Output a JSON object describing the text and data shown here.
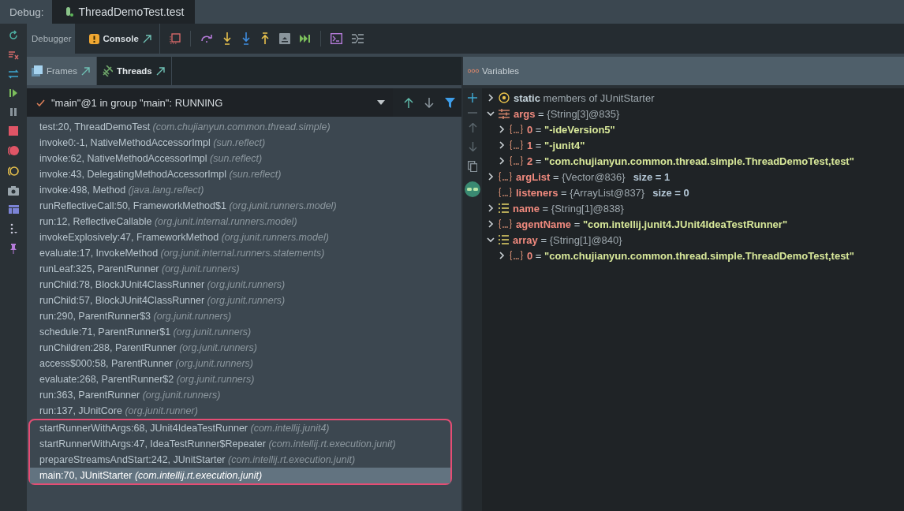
{
  "debug_bar": {
    "label": "Debug:",
    "tab": {
      "title": "ThreadDemoTest.test",
      "selected": true
    }
  },
  "tool_tabs": [
    {
      "label": "Debugger",
      "selected": true,
      "kind": "plain"
    },
    {
      "label": "Console",
      "selected": false,
      "kind": "warning"
    }
  ],
  "frame_tabs": [
    {
      "label": "Frames",
      "selected": true,
      "kind": "frames"
    },
    {
      "label": "Threads",
      "selected": false,
      "kind": "threads"
    }
  ],
  "thread_selector": {
    "value": "\"main\"@1 in group \"main\": RUNNING"
  },
  "frames": [
    {
      "location": "test:20, ThreadDemoTest",
      "package": "(com.chujianyun.common.thread.simple)",
      "selected": false,
      "marked": false
    },
    {
      "location": "invoke0:-1, NativeMethodAccessorImpl",
      "package": "(sun.reflect)",
      "selected": false,
      "marked": false
    },
    {
      "location": "invoke:62, NativeMethodAccessorImpl",
      "package": "(sun.reflect)",
      "selected": false,
      "marked": false
    },
    {
      "location": "invoke:43, DelegatingMethodAccessorImpl",
      "package": "(sun.reflect)",
      "selected": false,
      "marked": false
    },
    {
      "location": "invoke:498, Method",
      "package": "(java.lang.reflect)",
      "selected": false,
      "marked": false
    },
    {
      "location": "runReflectiveCall:50, FrameworkMethod$1",
      "package": "(org.junit.runners.model)",
      "selected": false,
      "marked": false
    },
    {
      "location": "run:12, ReflectiveCallable",
      "package": "(org.junit.internal.runners.model)",
      "selected": false,
      "marked": false
    },
    {
      "location": "invokeExplosively:47, FrameworkMethod",
      "package": "(org.junit.runners.model)",
      "selected": false,
      "marked": false
    },
    {
      "location": "evaluate:17, InvokeMethod",
      "package": "(org.junit.internal.runners.statements)",
      "selected": false,
      "marked": false
    },
    {
      "location": "runLeaf:325, ParentRunner",
      "package": "(org.junit.runners)",
      "selected": false,
      "marked": false
    },
    {
      "location": "runChild:78, BlockJUnit4ClassRunner",
      "package": "(org.junit.runners)",
      "selected": false,
      "marked": false
    },
    {
      "location": "runChild:57, BlockJUnit4ClassRunner",
      "package": "(org.junit.runners)",
      "selected": false,
      "marked": false
    },
    {
      "location": "run:290, ParentRunner$3",
      "package": "(org.junit.runners)",
      "selected": false,
      "marked": false
    },
    {
      "location": "schedule:71, ParentRunner$1",
      "package": "(org.junit.runners)",
      "selected": false,
      "marked": false
    },
    {
      "location": "runChildren:288, ParentRunner",
      "package": "(org.junit.runners)",
      "selected": false,
      "marked": false
    },
    {
      "location": "access$000:58, ParentRunner",
      "package": "(org.junit.runners)",
      "selected": false,
      "marked": false
    },
    {
      "location": "evaluate:268, ParentRunner$2",
      "package": "(org.junit.runners)",
      "selected": false,
      "marked": false
    },
    {
      "location": "run:363, ParentRunner",
      "package": "(org.junit.runners)",
      "selected": false,
      "marked": false
    },
    {
      "location": "run:137, JUnitCore",
      "package": "(org.junit.runner)",
      "selected": false,
      "marked": false
    },
    {
      "location": "startRunnerWithArgs:68, JUnit4IdeaTestRunner",
      "package": "(com.intellij.junit4)",
      "selected": false,
      "marked": true
    },
    {
      "location": "startRunnerWithArgs:47, IdeaTestRunner$Repeater",
      "package": "(com.intellij.rt.execution.junit)",
      "selected": false,
      "marked": true
    },
    {
      "location": "prepareStreamsAndStart:242, JUnitStarter",
      "package": "(com.intellij.rt.execution.junit)",
      "selected": false,
      "marked": true
    },
    {
      "location": "main:70, JUnitStarter",
      "package": "(com.intellij.rt.execution.junit)",
      "selected": true,
      "marked": true
    }
  ],
  "variables": {
    "title": "Variables",
    "nodes": [
      {
        "kind": "static",
        "expandable": true,
        "expanded": false,
        "name": "static",
        "value": "members of JUnitStarter",
        "string_value": false
      },
      {
        "kind": "params",
        "expandable": true,
        "expanded": true,
        "name": "args",
        "operator": "=",
        "value": "{String[3]@835}",
        "string_value": false,
        "children": [
          {
            "kind": "object",
            "expandable": true,
            "expanded": false,
            "name": "0",
            "operator": "=",
            "value": "\"-ideVersion5\"",
            "string_value": true
          },
          {
            "kind": "object",
            "expandable": true,
            "expanded": false,
            "name": "1",
            "operator": "=",
            "value": "\"-junit4\"",
            "string_value": true
          },
          {
            "kind": "object",
            "expandable": true,
            "expanded": false,
            "name": "2",
            "operator": "=",
            "value": "\"com.chujianyun.common.thread.simple.ThreadDemoTest,test\"",
            "string_value": true
          }
        ]
      },
      {
        "kind": "object",
        "expandable": true,
        "expanded": false,
        "name": "argList",
        "operator": "=",
        "value": "{Vector@836}",
        "string_value": false,
        "extra": "size = 1"
      },
      {
        "kind": "object",
        "expandable": false,
        "name": "listeners",
        "operator": "=",
        "value": "{ArrayList@837}",
        "string_value": false,
        "extra": "size = 0"
      },
      {
        "kind": "list",
        "expandable": true,
        "expanded": false,
        "name": "name",
        "operator": "=",
        "value": "{String[1]@838}",
        "string_value": false
      },
      {
        "kind": "object",
        "expandable": true,
        "expanded": false,
        "name": "agentName",
        "operator": "=",
        "value": "\"com.intellij.junit4.JUnit4IdeaTestRunner\"",
        "string_value": true
      },
      {
        "kind": "list",
        "expandable": true,
        "expanded": true,
        "name": "array",
        "operator": "=",
        "value": "{String[1]@840}",
        "string_value": false,
        "children": [
          {
            "kind": "object",
            "expandable": true,
            "expanded": false,
            "name": "0",
            "operator": "=",
            "value": "\"com.chujianyun.common.thread.simple.ThreadDemoTest,test\"",
            "string_value": true
          }
        ]
      }
    ]
  }
}
